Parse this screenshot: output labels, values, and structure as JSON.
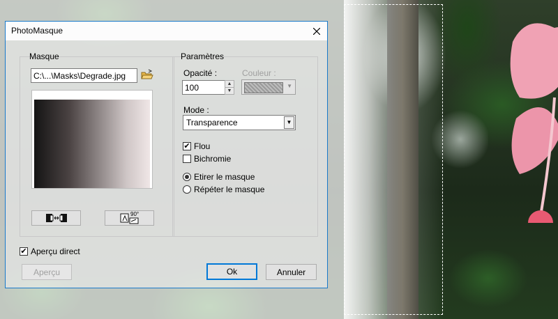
{
  "dialog": {
    "title": "PhotoMasque",
    "mask_group": {
      "label": "Masque",
      "file_path": "C:\\...\\Masks\\Degrade.jpg",
      "flip_button_icon": "flip-horizontal-icon",
      "rotate_button_icon": "rotate-90-icon",
      "rotate_button_text": "90°"
    },
    "params_group": {
      "label": "Paramètres",
      "opacity_label": "Opacité :",
      "opacity_value": "100",
      "color_label": "Couleur :",
      "mode_label": "Mode :",
      "mode_value": "Transparence",
      "flou_label": "Flou",
      "flou_checked": true,
      "bichromie_label": "Bichromie",
      "bichromie_checked": false,
      "stretch_label": "Etirer le masque",
      "repeat_label": "Répéter le masque",
      "selected_option": "Etirer le masque"
    },
    "live_preview_label": "Aperçu direct",
    "live_preview_checked": true,
    "preview_button": "Aperçu",
    "ok_button": "Ok",
    "cancel_button": "Annuler"
  },
  "colors": {
    "accent": "#0078d7",
    "title_border": "#1979ca"
  }
}
